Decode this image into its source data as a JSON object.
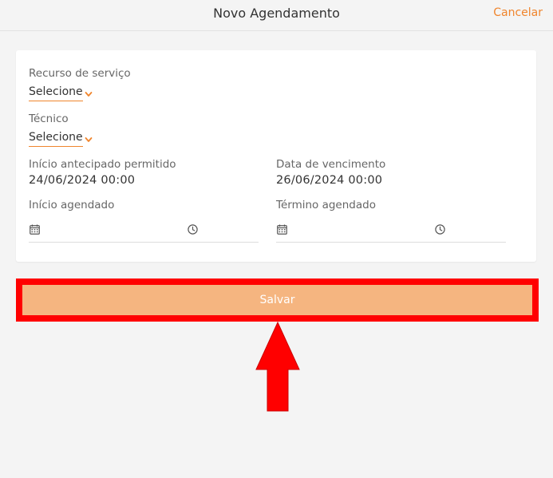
{
  "header": {
    "title": "Novo Agendamento",
    "cancel_label": "Cancelar"
  },
  "form": {
    "recurso": {
      "label": "Recurso de serviço",
      "value": "Selecione"
    },
    "tecnico": {
      "label": "Técnico",
      "value": "Selecione"
    },
    "inicio_antecipado": {
      "label": "Início antecipado permitido",
      "value": "24/06/2024 00:00"
    },
    "data_vencimento": {
      "label": "Data de vencimento",
      "value": "26/06/2024 00:00"
    },
    "inicio_agendado": {
      "label": "Início agendado",
      "value": ""
    },
    "termino_agendado": {
      "label": "Término agendado",
      "value": ""
    }
  },
  "save_label": "Salvar",
  "colors": {
    "accent": "#f0852d",
    "save_button": "#f5b580",
    "highlight": "#ff0000"
  },
  "icons": [
    "chevron-down-icon",
    "calendar-icon",
    "clock-icon",
    "arrow-up-icon"
  ]
}
